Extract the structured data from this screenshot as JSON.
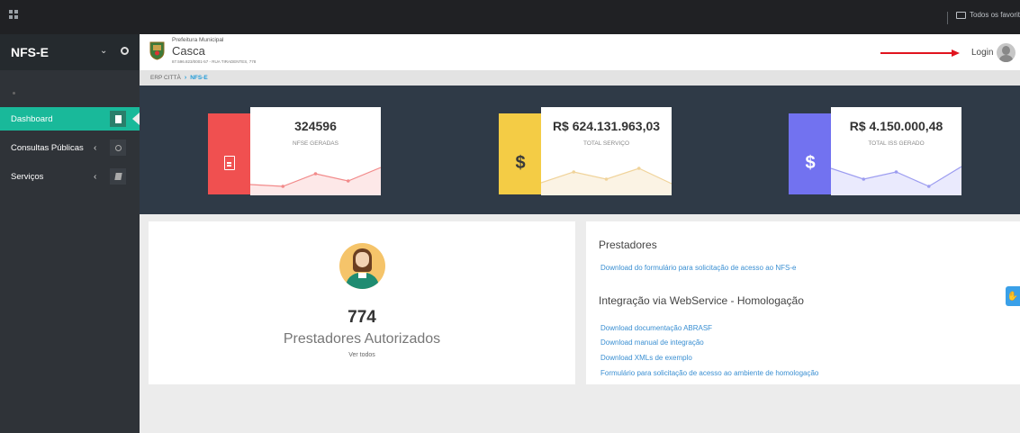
{
  "browser": {
    "favorites_label": "Todos os favoritos"
  },
  "sidebar": {
    "title": "NFS-E",
    "items": [
      {
        "label": "Dashboard",
        "active": true,
        "icon": "document-icon"
      },
      {
        "label": "Consultas Públicas",
        "active": false,
        "icon": "search-icon"
      },
      {
        "label": "Serviços",
        "active": false,
        "icon": "book-icon"
      }
    ]
  },
  "header": {
    "municipality_label": "Prefeitura Municipal",
    "city": "Casca",
    "address": "87.596.823/0001-57 - RUA TIRADENTES, 778",
    "login_label": "Login"
  },
  "breadcrumb": {
    "root": "ERP CITTÀ",
    "current": "NFS-E"
  },
  "stats": [
    {
      "value": "324596",
      "caption": "NFSE GERADAS",
      "color": "#f05050",
      "icon": "document-icon",
      "chart_color": "#f28a8a",
      "fill": "#fde8e8",
      "points": [
        12,
        10,
        24,
        16,
        31
      ]
    },
    {
      "value": "R$ 624.131.963,03",
      "caption": "TOTAL SERVIÇO",
      "color": "#f4cc45",
      "icon": "dollar-icon",
      "chart_color": "#f0d39a",
      "fill": "#fbf3e4",
      "points": [
        14,
        26,
        18,
        30,
        13
      ]
    },
    {
      "value": "R$ 4.150.000,48",
      "caption": "TOTAL ISS GERADO",
      "color": "#7272f0",
      "icon": "dollar-icon",
      "chart_color": "#9c9cf0",
      "fill": "#eaeafd",
      "points": [
        30,
        18,
        26,
        10,
        32
      ]
    }
  ],
  "prestadores": {
    "count": "774",
    "label": "Prestadores Autorizados",
    "link": "Ver todos"
  },
  "downloads": {
    "section1_title": "Prestadores",
    "section1_links": [
      "Download do formulário para solicitação de acesso ao NFS-e"
    ],
    "section2_title": "Integração via WebService - Homologação",
    "section2_links": [
      "Download documentação ABRASF",
      "Download manual de integração",
      "Download XMLs de exemplo",
      "Formulário para solicitação de acesso ao ambiente de homologação"
    ]
  },
  "floating_button": {
    "icon": "accessibility-hand-icon"
  }
}
